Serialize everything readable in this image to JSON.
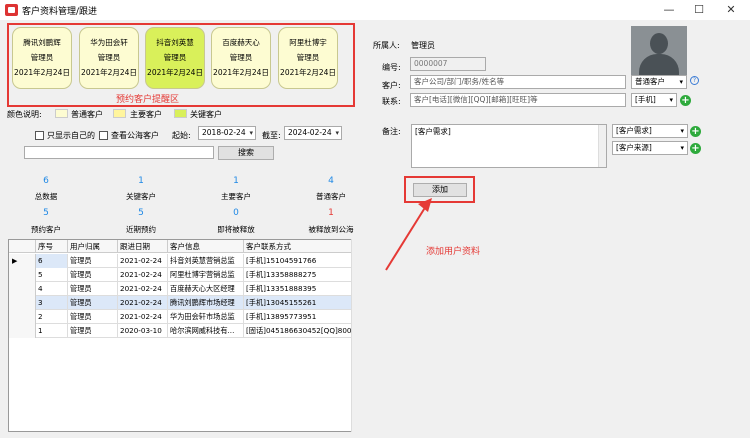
{
  "window": {
    "title": "客户资料管理/跟进",
    "controls": {
      "minimize": "—",
      "maximize": "☐",
      "close": "✕"
    }
  },
  "reminder": {
    "label": "预约客户提醒区",
    "cards": [
      {
        "name": "腾讯刘鹏辉",
        "owner": "管理员",
        "date": "2021年2月24日",
        "style": "normal"
      },
      {
        "name": "华为田会轩",
        "owner": "管理员",
        "date": "2021年2月24日",
        "style": "normal"
      },
      {
        "name": "抖音刘英慧",
        "owner": "管理员",
        "date": "2021年2月24日",
        "style": "key"
      },
      {
        "name": "百度赫天心",
        "owner": "管理员",
        "date": "2021年2月24日",
        "style": "normal"
      },
      {
        "name": "阿里杜博宇",
        "owner": "管理员",
        "date": "2021年2月24日",
        "style": "normal"
      }
    ]
  },
  "legend": {
    "title": "颜色说明:",
    "items": [
      {
        "label": "普通客户",
        "color": "#fdfcd2"
      },
      {
        "label": "主要客户",
        "color": "#fff59d"
      },
      {
        "label": "关键客户",
        "color": "#d9f05a"
      }
    ]
  },
  "filters": {
    "only_mine": "只显示自己的",
    "view_public": "查看公海客户",
    "start_label": "起始:",
    "start_date": "2018-02-24",
    "end_label": "截至:",
    "end_date": "2024-02-24",
    "search_button": "搜索"
  },
  "stats": [
    {
      "value": "6",
      "label": "总数据"
    },
    {
      "value": "1",
      "label": "关键客户"
    },
    {
      "value": "1",
      "label": "主要客户"
    },
    {
      "value": "4",
      "label": "普通客户"
    },
    {
      "value": "5",
      "label": "预约客户"
    },
    {
      "value": "5",
      "label": "近期预约"
    },
    {
      "value": "0",
      "label": "即将被释放"
    },
    {
      "value": "1",
      "label": "被释放到公海",
      "color": "#e53935"
    }
  ],
  "grid": {
    "columns": [
      "序号",
      "用户归属",
      "跟进日期",
      "客户信息",
      "客户联系方式"
    ],
    "rows": [
      [
        "6",
        "管理员",
        "2021-02-24",
        "抖音刘英慧营销总监",
        "[手机]15104591766"
      ],
      [
        "5",
        "管理员",
        "2021-02-24",
        "阿里杜博宇营销总监",
        "[手机]13358888275"
      ],
      [
        "4",
        "管理员",
        "2021-02-24",
        "百度赫天心大区经理",
        "[手机]13351888395"
      ],
      [
        "3",
        "管理员",
        "2021-02-24",
        "腾讯刘鹏辉市场经理",
        "[手机]13045155261"
      ],
      [
        "2",
        "管理员",
        "2021-02-24",
        "华为田会轩市场总监",
        "[手机]13895773951"
      ],
      [
        "1",
        "管理员",
        "2020-03-10",
        "哈尔滨网威科技有...",
        "[固话]045186630452[QQ]8001856"
      ]
    ],
    "selected_marker": "▶"
  },
  "form": {
    "owner_label": "所属人:",
    "owner_value": "管理员",
    "id_label": "编号:",
    "id_value": "0000007",
    "customer_label": "客户:",
    "customer_placeholder": "客户公司/部门/职务/姓名等",
    "customer_type": "普通客户",
    "contact_label": "联系:",
    "contact_placeholder": "客户[电话][微信][QQ][邮箱][旺旺]等",
    "contact_type": "[手机]",
    "notes_label": "备注:",
    "notes_value": "[客户需求]",
    "need_select": "[客户需求]",
    "source_select": "[客户来源]",
    "add_button": "添加",
    "add_note": "添加用户资料"
  }
}
